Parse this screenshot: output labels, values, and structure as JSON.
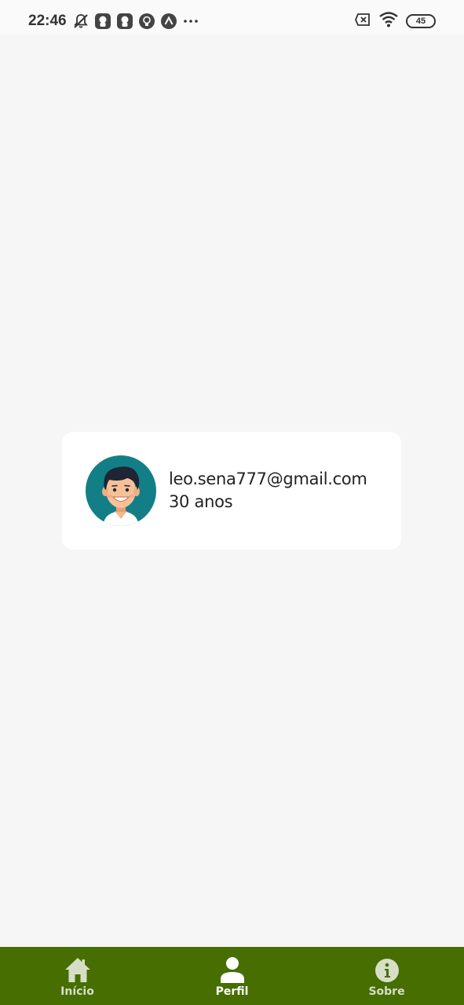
{
  "status_bar": {
    "time": "22:46",
    "battery": "45",
    "icons": [
      "muted-bell-icon",
      "app-notification-icon",
      "app-notification-icon",
      "lightbulb-icon",
      "caret-up-icon",
      "more-dots-icon",
      "sim-x-icon",
      "wifi-icon",
      "battery-icon"
    ]
  },
  "profile": {
    "email": "leo.sena777@gmail.com",
    "age": "30 anos",
    "avatar": "avatar-icon"
  },
  "bottom_nav": {
    "background": "#466e00",
    "items": [
      {
        "label": "Início",
        "icon": "home-icon",
        "active": false
      },
      {
        "label": "Perfil",
        "icon": "person-icon",
        "active": true
      },
      {
        "label": "Sobre",
        "icon": "info-icon",
        "active": false
      }
    ]
  }
}
